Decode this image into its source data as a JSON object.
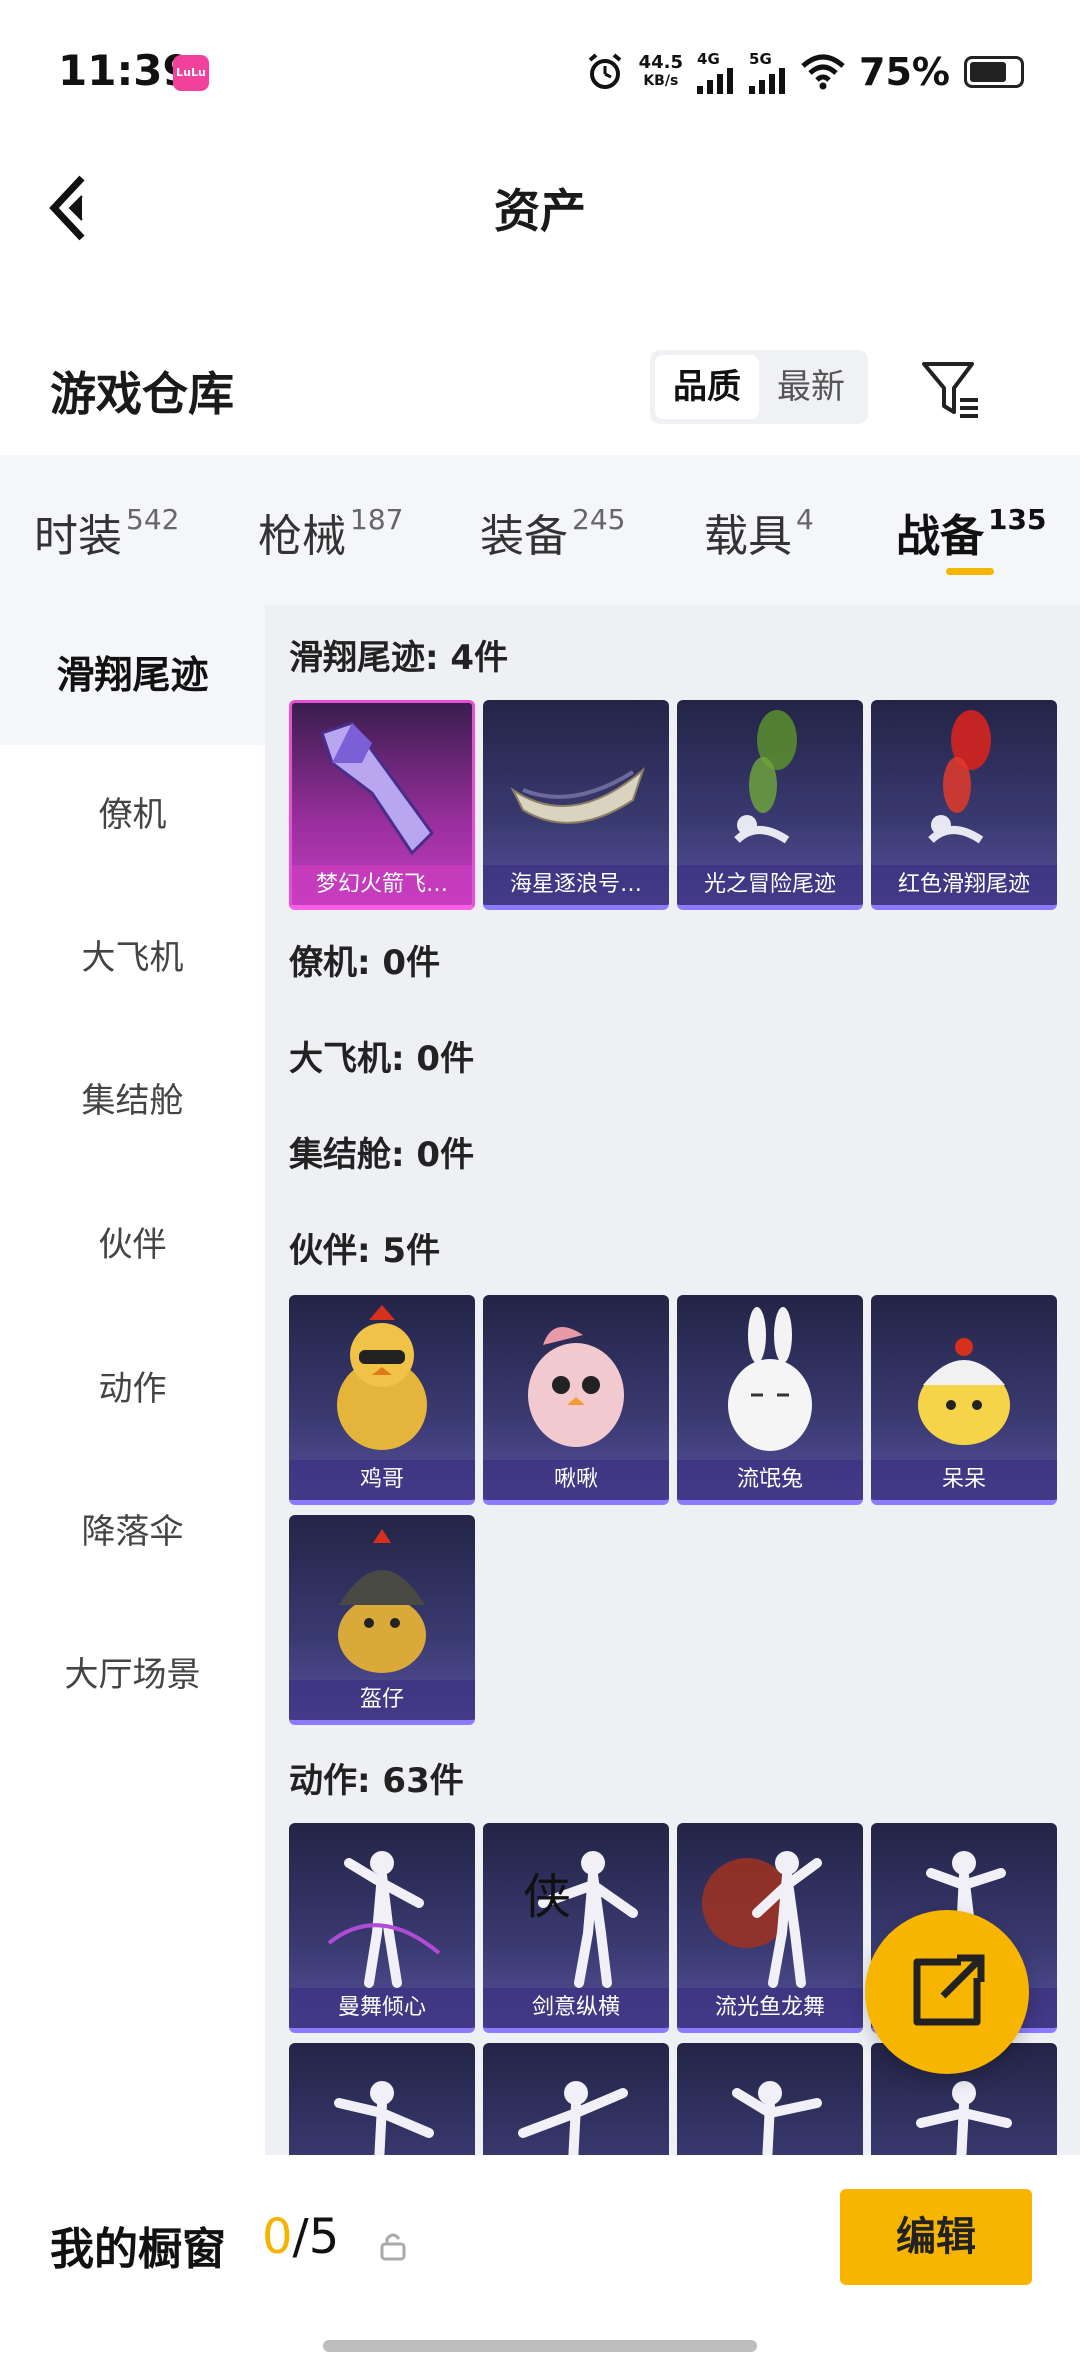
{
  "status_bar": {
    "time": "11:39",
    "app_badge": "LuLu",
    "net_speed_value": "44.5",
    "net_speed_unit": "KB/s",
    "signal1": "4G",
    "signal2": "5G",
    "battery_pct": "75%"
  },
  "nav": {
    "title": "资产"
  },
  "warehouse": {
    "title": "游戏仓库",
    "sort_options": [
      "品质",
      "最新"
    ],
    "active_sort": "品质"
  },
  "tabs": [
    {
      "label": "时装",
      "count": "542"
    },
    {
      "label": "枪械",
      "count": "187"
    },
    {
      "label": "装备",
      "count": "245"
    },
    {
      "label": "载具",
      "count": "4"
    },
    {
      "label": "战备",
      "count": "135"
    }
  ],
  "active_tab": "战备",
  "sidebar": {
    "items": [
      "滑翔尾迹",
      "僚机",
      "大飞机",
      "集结舱",
      "伙伴",
      "动作",
      "降落伞",
      "大厅场景"
    ]
  },
  "sections": {
    "glide_title": "滑翔尾迹: 4件",
    "glide_items": [
      "梦幻火箭飞…",
      "海星逐浪号…",
      "光之冒险尾迹",
      "红色滑翔尾迹"
    ],
    "wingman_title": "僚机: 0件",
    "plane_title": "大飞机: 0件",
    "pod_title": "集结舱: 0件",
    "partner_title": "伙伴: 5件",
    "partner_items": [
      "鸡哥",
      "啾啾",
      "流氓兔",
      "呆呆",
      "盔仔"
    ],
    "emote_title": "动作: 63件",
    "emote_items": [
      "曼舞倾心",
      "剑意纵横",
      "流光鱼龙舞",
      ""
    ]
  },
  "bottom_bar": {
    "showcase_label": "我的橱窗",
    "showcase_current": "0",
    "showcase_total": "/5",
    "edit_label": "编辑"
  },
  "colors": {
    "accent": "#f7b500",
    "card_bg": "#2e2d5c",
    "pink_card": "#c33ec0"
  }
}
